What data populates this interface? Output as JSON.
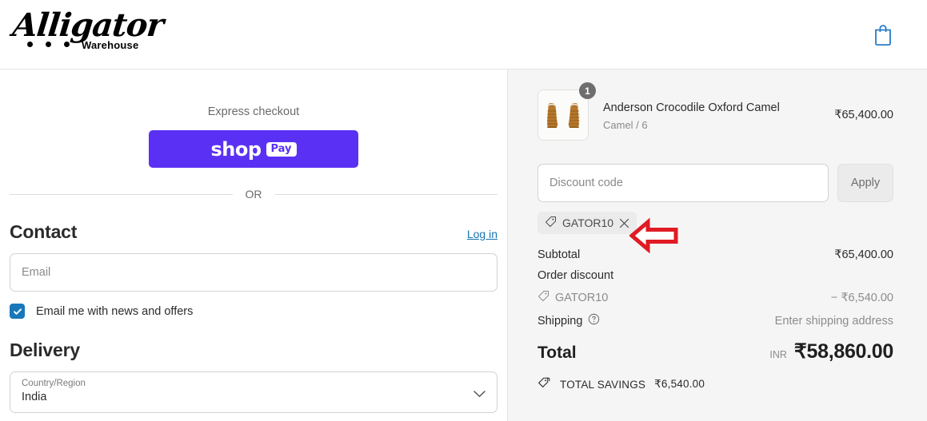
{
  "header": {
    "logo_script": "Alligator",
    "logo_sub": "Warehouse",
    "cart_icon": "shopping-bag-icon"
  },
  "left": {
    "express_label": "Express checkout",
    "shop_pay": {
      "word": "shop",
      "badge": "Pay"
    },
    "or_text": "OR",
    "contact": {
      "title": "Contact",
      "login_label": "Log in",
      "email_placeholder": "Email",
      "newsletter_label": "Email me with news and offers",
      "newsletter_checked": true,
      "checkbox_color": "#1878b9"
    },
    "delivery": {
      "title": "Delivery",
      "country_label": "Country/Region",
      "country_value": "India",
      "chevron_icon": "chevron-down-icon"
    }
  },
  "summary": {
    "item": {
      "title": "Anderson Crocodile Oxford Camel",
      "variant": "Camel / 6",
      "price": "₹65,400.00",
      "quantity": "1",
      "image_alt": "brown crocodile oxford shoes pair"
    },
    "discount": {
      "placeholder": "Discount code",
      "apply_label": "Apply",
      "applied_code": "GATOR10",
      "tag_icon": "tag-icon",
      "remove_icon": "close-icon"
    },
    "rows": [
      {
        "label": "Subtotal",
        "value": "₹65,400.00",
        "muted": false,
        "icon": null
      },
      {
        "label": "Order discount",
        "value": "",
        "muted": false,
        "icon": null
      },
      {
        "label": "GATOR10",
        "value": "− ₹6,540.00",
        "muted": true,
        "icon": "tag-icon"
      },
      {
        "label": "Shipping",
        "value": "Enter shipping address",
        "muted": false,
        "icon": "help-icon"
      }
    ],
    "total": {
      "label": "Total",
      "currency": "INR",
      "amount": "₹58,860.00"
    },
    "savings": {
      "icon": "savings-tag-icon",
      "label": "TOTAL SAVINGS",
      "amount": "₹6,540.00"
    }
  },
  "annotation": {
    "arrow": "left-pointing-arrow",
    "color": "#e01b24"
  },
  "theme": {
    "shop_pay_purple": "#5a31f4",
    "link_blue": "#1773b0",
    "panel_grey": "#f5f5f5"
  }
}
